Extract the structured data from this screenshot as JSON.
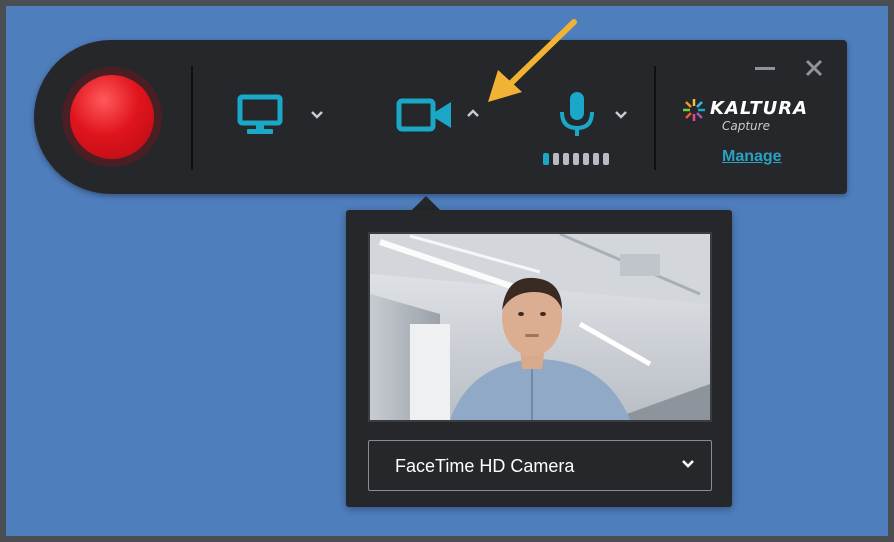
{
  "colors": {
    "background": "#4f7ebd",
    "toolbar": "#25272b",
    "accent": "#1aa7c8",
    "record": "#e0141d",
    "annotation_arrow": "#f2b233"
  },
  "toolbar": {
    "record_icon": "record-icon",
    "screen": {
      "icon": "monitor-icon",
      "chevron": "chevron-down-icon"
    },
    "camera": {
      "icon": "video-camera-icon",
      "chevron": "chevron-up-icon"
    },
    "microphone": {
      "icon": "microphone-icon",
      "chevron": "chevron-down-icon",
      "level_bars_total": 7,
      "level_bars_lit": 1
    },
    "window_controls": {
      "minimize": "minimize-icon",
      "close": "close-icon"
    },
    "brand": {
      "name": "KALTURA",
      "product": "Capture",
      "manage_label": "Manage"
    }
  },
  "camera_popup": {
    "preview_icon": "webcam-preview-image",
    "selected_camera": "FaceTime HD Camera",
    "dropdown_icon": "chevron-down-icon"
  }
}
